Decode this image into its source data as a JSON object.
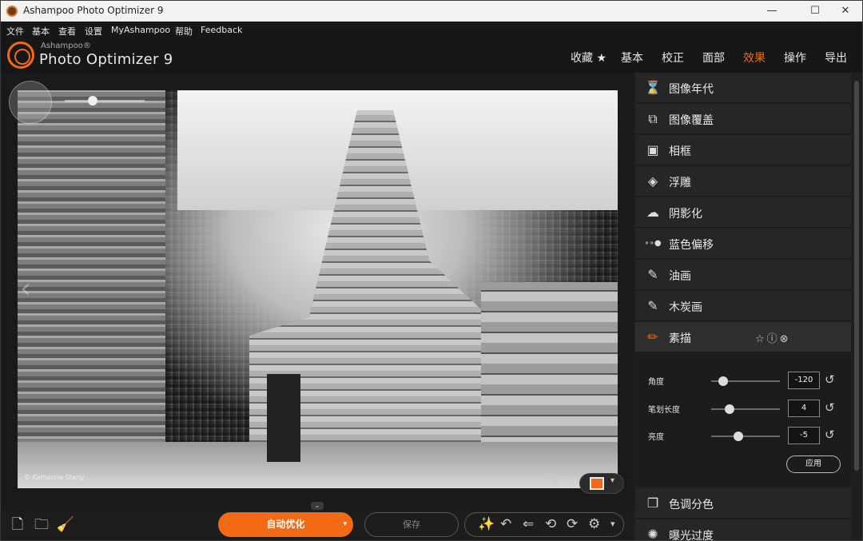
{
  "window": {
    "title": "Ashampoo Photo Optimizer 9",
    "min": "—",
    "max": "☐",
    "close": "✕"
  },
  "menu": [
    "文件",
    "基本",
    "查看",
    "设置",
    "MyAshampoo",
    "帮助",
    "Feedback"
  ],
  "logo": {
    "brand": "Ashampoo®",
    "product": "Photo Optimizer 9"
  },
  "topnav": [
    "收藏 ★",
    "基本",
    "校正",
    "面部",
    "效果",
    "操作",
    "导出"
  ],
  "topnav_active": "效果",
  "photo": {
    "caption": "© Katharina Starig"
  },
  "effects": [
    {
      "label": "图像年代",
      "icon": "hourglass-icon",
      "glyph": "⌛"
    },
    {
      "label": "图像覆盖",
      "icon": "image-overlay-icon",
      "glyph": "⧉"
    },
    {
      "label": "相框",
      "icon": "frame-icon",
      "glyph": "▣"
    },
    {
      "label": "浮雕",
      "icon": "emboss-icon",
      "glyph": "◈"
    },
    {
      "label": "阴影化",
      "icon": "shadow-cloud-icon",
      "glyph": "☁"
    },
    {
      "label": "蓝色偏移",
      "icon": "blue-shift-dots-icon",
      "glyph": "∘∘●"
    },
    {
      "label": "油画",
      "icon": "brush-icon",
      "glyph": "✎"
    },
    {
      "label": "木炭画",
      "icon": "charcoal-icon",
      "glyph": "✎"
    },
    {
      "label": "素描",
      "icon": "pencil-icon",
      "glyph": "✏"
    }
  ],
  "selected_effect_actions": "☆ⓘ⊗",
  "settings": {
    "angle": {
      "label": "角度",
      "value": "-120",
      "level": 0.17
    },
    "stroke": {
      "label": "笔划长度",
      "value": "4",
      "level": 0.27
    },
    "brightness": {
      "label": "亮度",
      "value": "-5",
      "level": 0.4
    },
    "reset_glyph": "↺",
    "apply": "应用"
  },
  "effects_after": [
    {
      "label": "色调分色",
      "icon": "posterize-icon",
      "glyph": "❐"
    },
    {
      "label": "曝光过度",
      "icon": "overexpose-icon",
      "glyph": "✺"
    }
  ],
  "bottom": {
    "auto_optimize": "自动优化",
    "save": "保存",
    "add_file_glyph": "🗋",
    "add_folder_glyph": "🗀",
    "clean_glyph": "🧹",
    "tools": [
      "✨",
      "↶",
      "⇐",
      "⟲",
      "⟳",
      "⚙",
      "▾"
    ]
  },
  "accent": "#f26a13"
}
